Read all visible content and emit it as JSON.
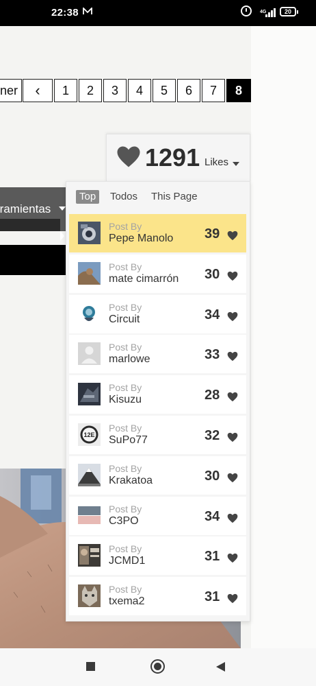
{
  "status_bar": {
    "time": "22:38",
    "network": "4G",
    "battery": "20"
  },
  "pagination": {
    "partial_label": "ner",
    "prev_label": "‹",
    "pages": [
      "1",
      "2",
      "3",
      "4",
      "5",
      "6",
      "7",
      "8"
    ],
    "active_page": "8"
  },
  "menu": {
    "partial_label": "rramientas"
  },
  "likes": {
    "count": "1291",
    "label": "Likes",
    "tabs": [
      "Top",
      "Todos",
      "This Page"
    ],
    "active_tab": "Top",
    "post_by_label": "Post By",
    "rows": [
      {
        "user": "Pepe Manolo",
        "count": "39",
        "highlighted": true
      },
      {
        "user": "mate cimarrón",
        "count": "30"
      },
      {
        "user": "Circuit",
        "count": "34"
      },
      {
        "user": "marlowe",
        "count": "33"
      },
      {
        "user": "Kisuzu",
        "count": "28"
      },
      {
        "user": "SuPo77",
        "count": "32"
      },
      {
        "user": "Krakatoa",
        "count": "30"
      },
      {
        "user": "C3PO",
        "count": "34"
      },
      {
        "user": "JCMD1",
        "count": "31"
      },
      {
        "user": "txema2",
        "count": "31"
      }
    ]
  },
  "avatar_labels": {
    "supo77": "12E"
  },
  "colors": {
    "highlight": "#fbe48a",
    "heart": "#444444",
    "active_page": "#000000"
  }
}
